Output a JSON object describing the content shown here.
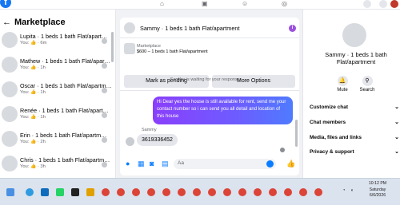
{
  "topbar": {
    "logo": "f",
    "icons": [
      "home-icon",
      "video-icon",
      "marketplace-icon",
      "groups-icon",
      "gaming-icon"
    ],
    "right_icons": [
      "menu-icon",
      "messenger-icon",
      "notifications-icon"
    ]
  },
  "left": {
    "back": "←",
    "title": "Marketplace",
    "conversations": [
      {
        "name": "Lupita · 1 beds 1 bath Flat/apart…",
        "meta": "You: 👍 · 6m"
      },
      {
        "name": "Mathew · 1 beds 1 bath Flat/apar…",
        "meta": "You: 👍 · 1h"
      },
      {
        "name": "Oscar · 1 beds 1 bath Flat/apartm…",
        "meta": "You: 👍 · 1h"
      },
      {
        "name": "Renée · 1 beds 1 bath Flat/apart…",
        "meta": "You: 👍 · 1h"
      },
      {
        "name": "Erin · 1 beds 1 bath Flat/apartm…",
        "meta": "You: 👍 · 2h"
      },
      {
        "name": "Chris · 1 beds 1 bath Flat/apartm…",
        "meta": "You: 👍 · 3h"
      }
    ]
  },
  "chat": {
    "title": "Sammy · 1 beds 1 bath Flat/apartment",
    "listing_label": "Marketplace",
    "listing_price": "$600 – 1 beds 1 bath Flat/apartment",
    "mark_pending": "Mark as pending",
    "more_options": "More Options",
    "waiting": "Sammy is waiting for your response.",
    "outgoing_message": "Hi Dear yes the house is still available for rent, send me your contact number so i can send you all detail and location of this house",
    "sender": "Sammy",
    "incoming_message": "3619336452",
    "composer_placeholder": "Aa"
  },
  "right": {
    "name": "Sammy · 1 beds 1 bath Flat/apartment",
    "mute": "Mute",
    "search": "Search",
    "rows": [
      "Customize chat",
      "Chat members",
      "Media, files and links",
      "Privacy & support"
    ]
  },
  "taskbar": {
    "time": "10:12 PM",
    "day": "Saturday",
    "date": "6/6/2026",
    "colors": {
      "bar": "#dbe3ee",
      "accent": "#0a7cff"
    }
  }
}
